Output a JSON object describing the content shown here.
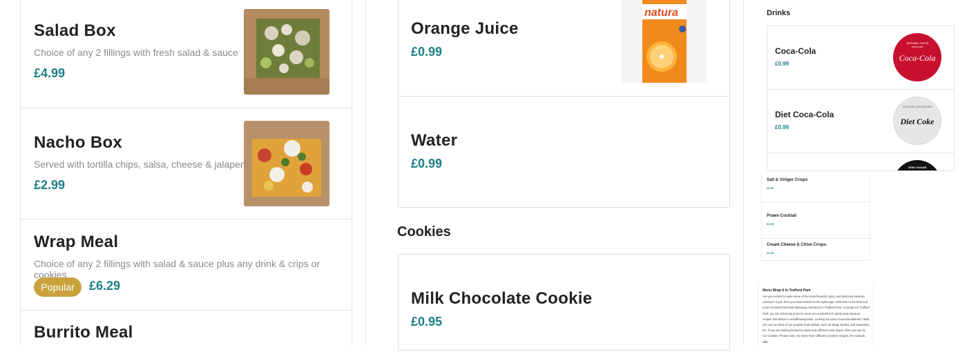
{
  "menu": {
    "items": [
      {
        "name": "Salad Box",
        "description": "Choice of any 2 fillings with fresh salad & sauce",
        "price": "£4.99"
      },
      {
        "name": "Nacho Box",
        "description": "Served with tortilla chips, salsa, cheese & jalapeno",
        "price": "£2.99"
      },
      {
        "name": "Wrap Meal",
        "description": "Choice of any 2 fillings with salad & sauce plus any drink & crips or cookies",
        "badge": "Popular",
        "price": "£6.29"
      },
      {
        "name": "Burrito Meal"
      }
    ]
  },
  "middle": {
    "drinks": [
      {
        "name": "Orange Juice",
        "price": "£0.99",
        "image_label": "natura"
      },
      {
        "name": "Water",
        "price": "£0.99"
      }
    ],
    "cookies_heading": "Cookies",
    "cookies": [
      {
        "name": "Milk Chocolate Cookie",
        "price": "£0.95"
      }
    ]
  },
  "right": {
    "drinks_heading": "Drinks",
    "drinks": [
      {
        "name": "Coca-Cola",
        "price": "£0.99",
        "logo_text": "Coca-Cola",
        "logo_top": "ORIGINAL TASTE",
        "logo_sub": "SINCE 1886",
        "logo_color": "#c8102e"
      },
      {
        "name": "Diet Coca-Cola",
        "price": "£0.99",
        "logo_text": "Diet Coke",
        "logo_top": "NO SUGAR • NO CALORIES",
        "logo_color": "#d9d9d9"
      },
      {
        "logo_top": "ZERO SUGAR",
        "logo_color": "#111111"
      }
    ],
    "crisps": [
      {
        "name": "Salt & Viniger Crisps",
        "price": "£0.95"
      },
      {
        "name": "Prawn Cocktail",
        "price": "£0.95"
      },
      {
        "name": "Cream Cheese & Chive Crisps",
        "price": "£0.95"
      }
    ],
    "about": {
      "title": "Menu Wrap It In Trafford Park",
      "text": "Are you excited to taste some of the most flavorful, spicy, and delicious Mexican cuisines? If yes, then you have landed on the right page. Welcome to the best and most renowned Mexican takeaway restaurant in Trafford Park. At Wrap It In Trafford Park, we are extremely proud to serve you a plentiful of utterly tasty Mexican recipes that deliver a mindblowing taste. Looking for some recommendations? Well, you can try some of our popular main dishes, such as Wrap, Burrito, and Salad Box etc. If you are looking forward to taste truly different and unique, then you can try our Cookies. Please note, we serve three different Cookies recipes, for example, Milk"
    }
  },
  "colors": {
    "price": "#1e7f86",
    "badge": "#c9a23c",
    "border": "#e4e4e4"
  }
}
